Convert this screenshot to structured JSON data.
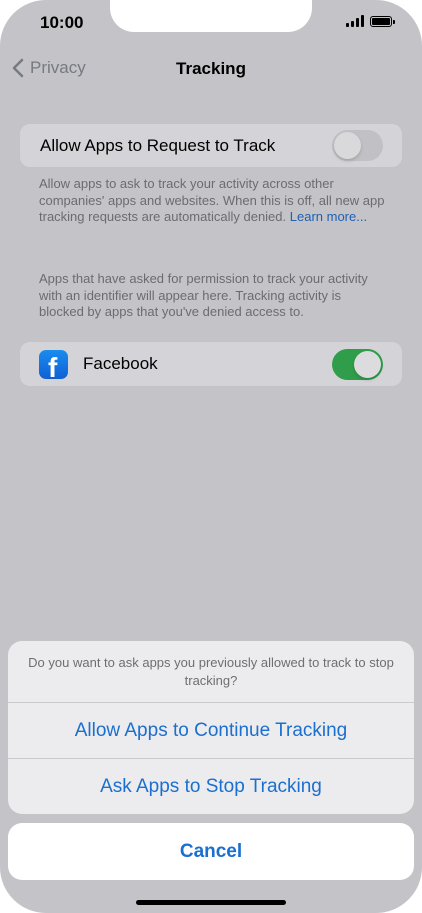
{
  "status_bar": {
    "time": "10:00"
  },
  "nav": {
    "back_label": "Privacy",
    "title": "Tracking"
  },
  "allow_request": {
    "label": "Allow Apps to Request to Track",
    "toggle_state": "off"
  },
  "allow_footnote": {
    "text": "Allow apps to ask to track your activity across other companies' apps and websites. When this is off, all new app tracking requests are automatically denied. ",
    "link": "Learn more..."
  },
  "apps_footnote": "Apps that have asked for permission to track your activity with an identifier will appear here. Tracking activity is blocked by apps that you've denied access to.",
  "apps": [
    {
      "name": "Facebook",
      "icon": "facebook-icon",
      "toggle_state": "on"
    }
  ],
  "action_sheet": {
    "message": "Do you want to ask apps you previously allowed to track to stop tracking?",
    "buttons": [
      "Allow Apps to Continue Tracking",
      "Ask Apps to Stop Tracking"
    ],
    "cancel": "Cancel"
  },
  "colors": {
    "accent": "#1a6fcf",
    "toggle_on": "#2f9d4a",
    "dimmed_background": "#c3c3c8"
  }
}
